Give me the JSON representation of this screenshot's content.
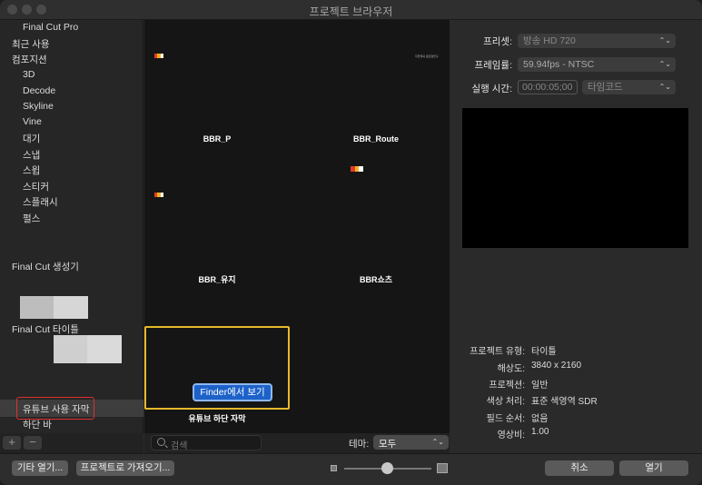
{
  "window": {
    "title": "프로젝트 브라우저"
  },
  "sidebar": {
    "items": [
      {
        "label": "Final Cut Pro"
      },
      {
        "label": "최근 사용"
      },
      {
        "label": "컴포지션"
      },
      {
        "label": "3D"
      },
      {
        "label": "Decode"
      },
      {
        "label": "Skyline"
      },
      {
        "label": "Vine"
      },
      {
        "label": "대기"
      },
      {
        "label": "스냅"
      },
      {
        "label": "스윕"
      },
      {
        "label": "스티커"
      },
      {
        "label": "스플래시"
      },
      {
        "label": "펄스"
      },
      {
        "label": "Final Cut 생성기"
      },
      {
        "label": "Final Cut 타이틀"
      },
      {
        "label": "유튜브 사용 자막"
      },
      {
        "label": "하단 바"
      }
    ],
    "add_label": "+",
    "remove_label": "−"
  },
  "browser": {
    "tiles": [
      {
        "label": "BBR_P"
      },
      {
        "label": "BBR_Route"
      },
      {
        "label": "BBR_유지"
      },
      {
        "label": "BBR쇼츠"
      },
      {
        "label": "유튜브 하단 자막"
      }
    ],
    "tiny_caption": "자연계곡 골모험연구",
    "finder_button": "Finder에서 보기",
    "search_placeholder": "검색",
    "theme_label": "테마:",
    "theme_value": "모두"
  },
  "inspector": {
    "preset_label": "프리셋:",
    "preset_value": "방송 HD 720",
    "framerate_label": "프레임률:",
    "framerate_value": "59.94fps - NTSC",
    "duration_label": "실행 시간:",
    "duration_value": "00:00:05;00",
    "duration_unit": "타임코드",
    "info": [
      {
        "label": "프로젝트 유형:",
        "value": "타이틀"
      },
      {
        "label": "해상도:",
        "value": "3840 x 2160"
      },
      {
        "label": "프로젝션:",
        "value": "일반"
      },
      {
        "label": "색상 처리:",
        "value": "표준 색영역 SDR"
      },
      {
        "label": "필드 순서:",
        "value": "없음"
      },
      {
        "label": "영상비:",
        "value": "1.00"
      }
    ]
  },
  "footer": {
    "open_other": "기타 열기...",
    "import_project": "프로젝트로 가져오기...",
    "cancel": "취소",
    "open": "열기",
    "thumbnail_size": 0.52
  },
  "colors": {
    "selection_border": "#e5b92a",
    "finder_button": "#1d62c9",
    "highlight_box": "#e03030"
  }
}
